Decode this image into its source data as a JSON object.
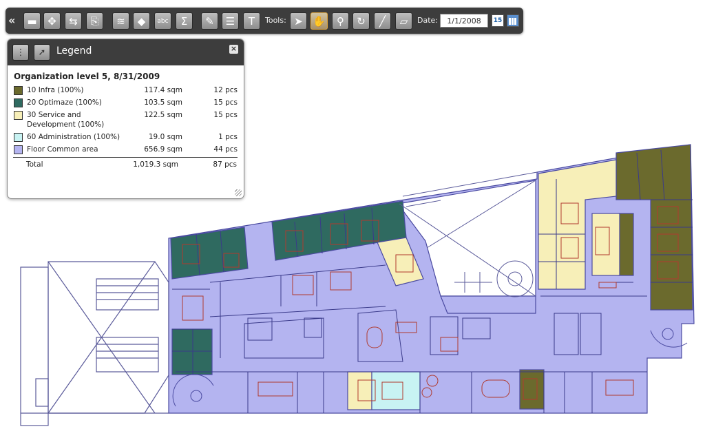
{
  "toolbar": {
    "collapse_glyph": "«",
    "buttons": [
      "folder-icon",
      "move-icon",
      "flip-icon",
      "pdf-icon",
      "layers-icon",
      "paint-bucket-icon",
      "spellcheck-icon",
      "sum-icon",
      "edit-pen-icon",
      "document-icon",
      "text-format-icon"
    ],
    "tools_label": "Tools:",
    "tools": [
      "pointer-icon",
      "hand-pan-icon",
      "zoom-icon",
      "rotate-icon",
      "ruler-icon",
      "eraser-icon"
    ],
    "active_tool": "hand-pan-icon",
    "date_label": "Date:",
    "date_value": "1/1/2008",
    "calendar_day": "15"
  },
  "legend": {
    "title": "Legend",
    "close_glyph": "×",
    "heading": "Organization level 5, 8/31/2009",
    "rows": [
      {
        "name": "10 Infra (100%)",
        "area": "117.4 sqm",
        "pcs": "12 pcs",
        "color": "#6b6a2d"
      },
      {
        "name": "20 Optimaze (100%)",
        "area": "103.5 sqm",
        "pcs": "15 pcs",
        "color": "#2f6a60"
      },
      {
        "name": "30 Service and Development (100%)",
        "area": "122.5 sqm",
        "pcs": "15 pcs",
        "color": "#f7efb8"
      },
      {
        "name": "60 Administration (100%)",
        "area": "19.0 sqm",
        "pcs": "1 pcs",
        "color": "#c8f3f3"
      },
      {
        "name": "Floor Common area",
        "area": "656.9 sqm",
        "pcs": "44 pcs",
        "color": "#b4b4f0"
      }
    ],
    "total": {
      "name": "Total",
      "area": "1,019.3 sqm",
      "pcs": "87 pcs"
    }
  },
  "colors": {
    "infra": "#6b6a2d",
    "optimaze": "#2f6a60",
    "service": "#f7efb8",
    "admin": "#c8f3f3",
    "common": "#b4b4f0",
    "walls": "#4a4aa0",
    "furniture": "#b03a2e"
  }
}
